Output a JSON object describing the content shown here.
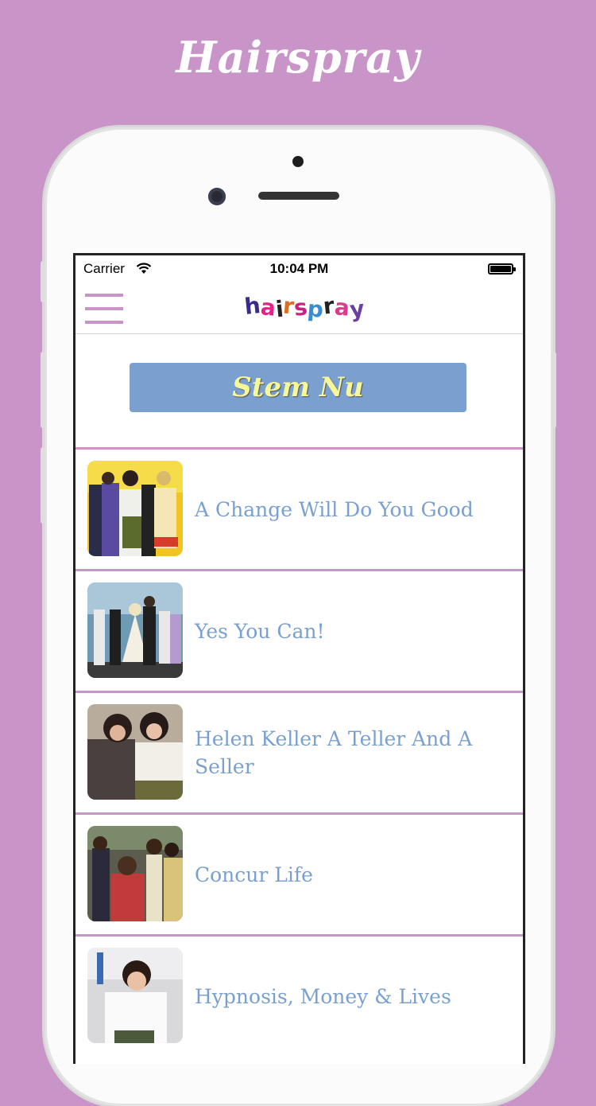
{
  "promo": {
    "title": "Hairspray"
  },
  "status_bar": {
    "carrier": "Carrier",
    "time": "10:04 PM"
  },
  "nav": {
    "logo_letters": [
      {
        "char": "h",
        "color": "#3b2a87"
      },
      {
        "char": "a",
        "color": "#e9208a"
      },
      {
        "char": "i",
        "color": "#2b1e1e"
      },
      {
        "char": "r",
        "color": "#e06d1f"
      },
      {
        "char": "s",
        "color": "#c7237f"
      },
      {
        "char": "p",
        "color": "#3a8cd0"
      },
      {
        "char": "r",
        "color": "#222222"
      },
      {
        "char": "a",
        "color": "#d93c8a"
      },
      {
        "char": "y",
        "color": "#6b3fa0"
      }
    ]
  },
  "vote_button": {
    "label": "Stem Nu"
  },
  "songs": [
    {
      "title": "A Change Will Do You Good"
    },
    {
      "title": "Yes You Can!"
    },
    {
      "title": "Helen Keller A Teller And A Seller"
    },
    {
      "title": "Concur Life"
    },
    {
      "title": "Hypnosis, Money & Lives"
    }
  ],
  "colors": {
    "background": "#c995c9",
    "accent_blue": "#7aa0cf",
    "button_text": "#f6f79a",
    "separator": "#c995c9"
  }
}
